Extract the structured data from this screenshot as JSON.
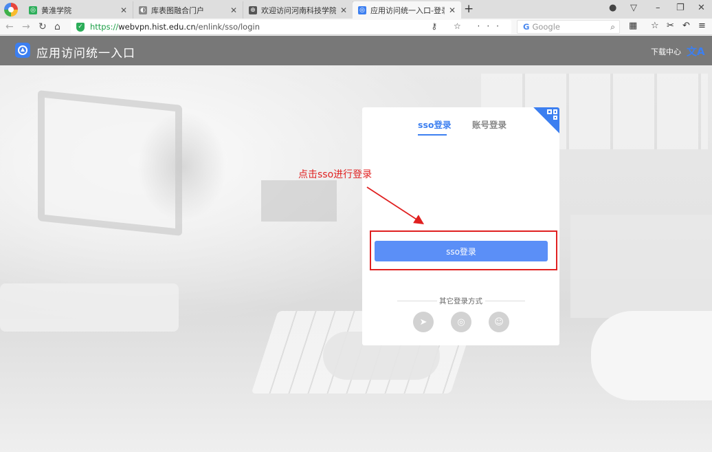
{
  "browser": {
    "tabs": [
      {
        "title": "黄淮学院",
        "fav_color": "#2dae5a",
        "fav_glyph": "◎"
      },
      {
        "title": "库表图融合门户",
        "fav_color": "#888888",
        "fav_glyph": "◐"
      },
      {
        "title": "欢迎访问河南科技学院官方网",
        "fav_color": "#555555",
        "fav_glyph": "⊕"
      },
      {
        "title": "应用访问统一入口-登录页",
        "fav_color": "#3c7ff0",
        "fav_glyph": "◎",
        "active": true
      }
    ],
    "new_tab": "+",
    "url_scheme": "https://",
    "url_host": "webvpn.hist.edu.cn",
    "url_path": "/enlink/sso/login",
    "search_engine": "G",
    "search_placeholder": "Google",
    "url_icons": "⚷ ☆ ···"
  },
  "site": {
    "title": "应用访问统一入口",
    "download_link": "下载中心",
    "lang_icon": "文A",
    "accent": "#3c7ff0"
  },
  "login": {
    "tab_sso": "sso登录",
    "tab_account": "账号登录",
    "sso_button": "sso登录",
    "other_methods": "其它登录方式"
  },
  "annotation": {
    "text": "点击sso进行登录",
    "color": "#e02020"
  }
}
